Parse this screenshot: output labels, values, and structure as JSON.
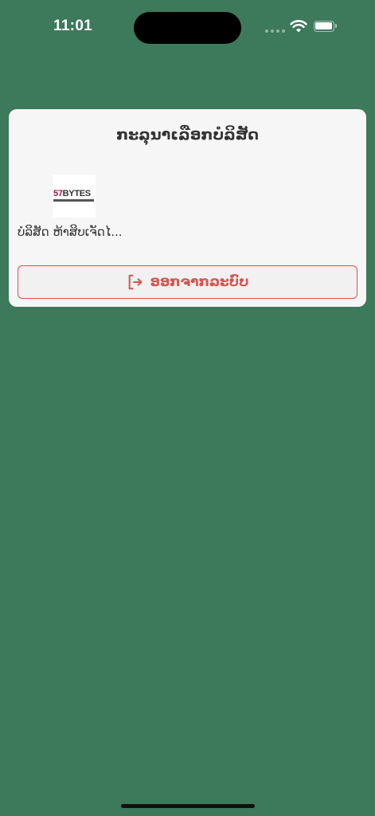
{
  "status_bar": {
    "time": "11:01"
  },
  "dialog": {
    "title": "ກະລຸນາເລືອກບໍລິສັດ",
    "company": {
      "logo_text_accent": "57",
      "logo_text_main": "BYTES",
      "name": "ບໍລິສັດ ຫ້າສິບເຈັດໄ..."
    },
    "logout_button": {
      "label": "ອອກຈາກລະບົບ",
      "icon": "logout-icon"
    }
  },
  "colors": {
    "background": "#3d795b",
    "card": "#f6f6f6",
    "danger": "#d9534f",
    "text": "#333333"
  }
}
